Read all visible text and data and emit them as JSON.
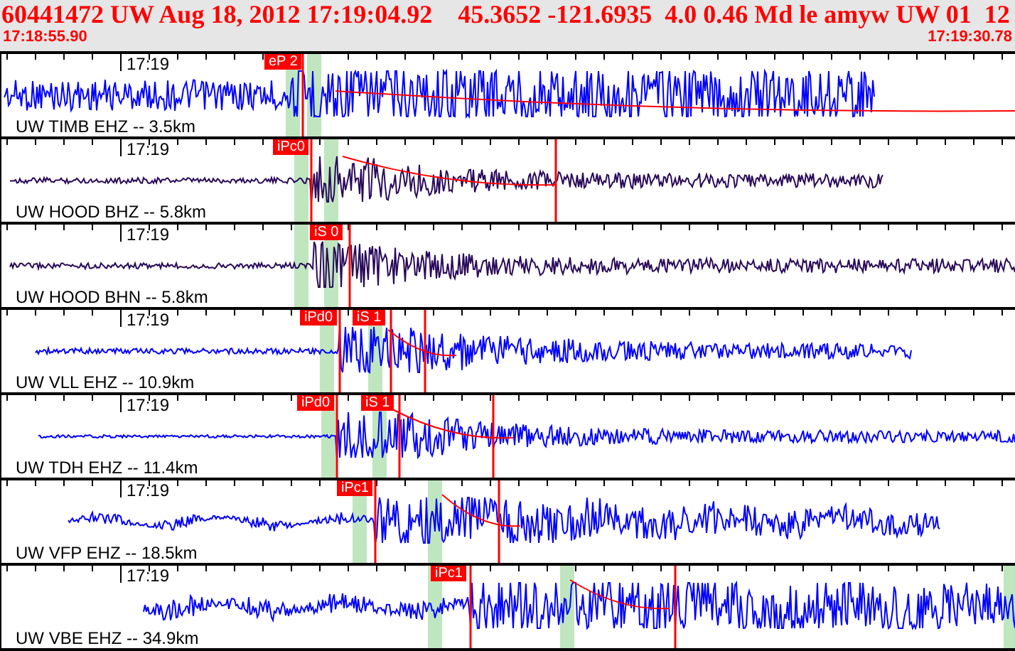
{
  "header": {
    "title": "60441472 UW Aug 18, 2012 17:19:04.92    45.3652 -121.6935  4.0 0.46 Md le amyw UW 01  12",
    "start_time": "17:18:55.90",
    "end_time": "17:19:30.78"
  },
  "traces": [
    {
      "station": "UW TIMB EHZ -- 3.5km",
      "time_label": "17:19",
      "color": "#0000ff",
      "picks": [
        {
          "label": "eP 2"
        }
      ]
    },
    {
      "station": "UW HOOD BHZ -- 5.8km",
      "time_label": "17:19",
      "color": "#2a0a5a",
      "picks": [
        {
          "label": "iPc0"
        }
      ]
    },
    {
      "station": "UW HOOD BHN -- 5.8km",
      "time_label": "17:19",
      "color": "#2a0a5a",
      "picks": [
        {
          "label": "iS 0"
        }
      ]
    },
    {
      "station": "UW VLL EHZ -- 10.9km",
      "time_label": "17:19",
      "color": "#0000ff",
      "picks": [
        {
          "label": "iPd0"
        },
        {
          "label": "iS 1"
        }
      ]
    },
    {
      "station": "UW TDH EHZ -- 11.4km",
      "time_label": "17:19",
      "color": "#0000ff",
      "picks": [
        {
          "label": "iPd0"
        },
        {
          "label": "iS 1"
        }
      ]
    },
    {
      "station": "UW VFP EHZ -- 18.5km",
      "time_label": "17:19",
      "color": "#0000ff",
      "picks": [
        {
          "label": "iPc1"
        }
      ]
    },
    {
      "station": "UW VBE EHZ -- 34.9km",
      "time_label": "17:19",
      "color": "#0000ff",
      "picks": [
        {
          "label": "iPc1"
        }
      ]
    }
  ]
}
